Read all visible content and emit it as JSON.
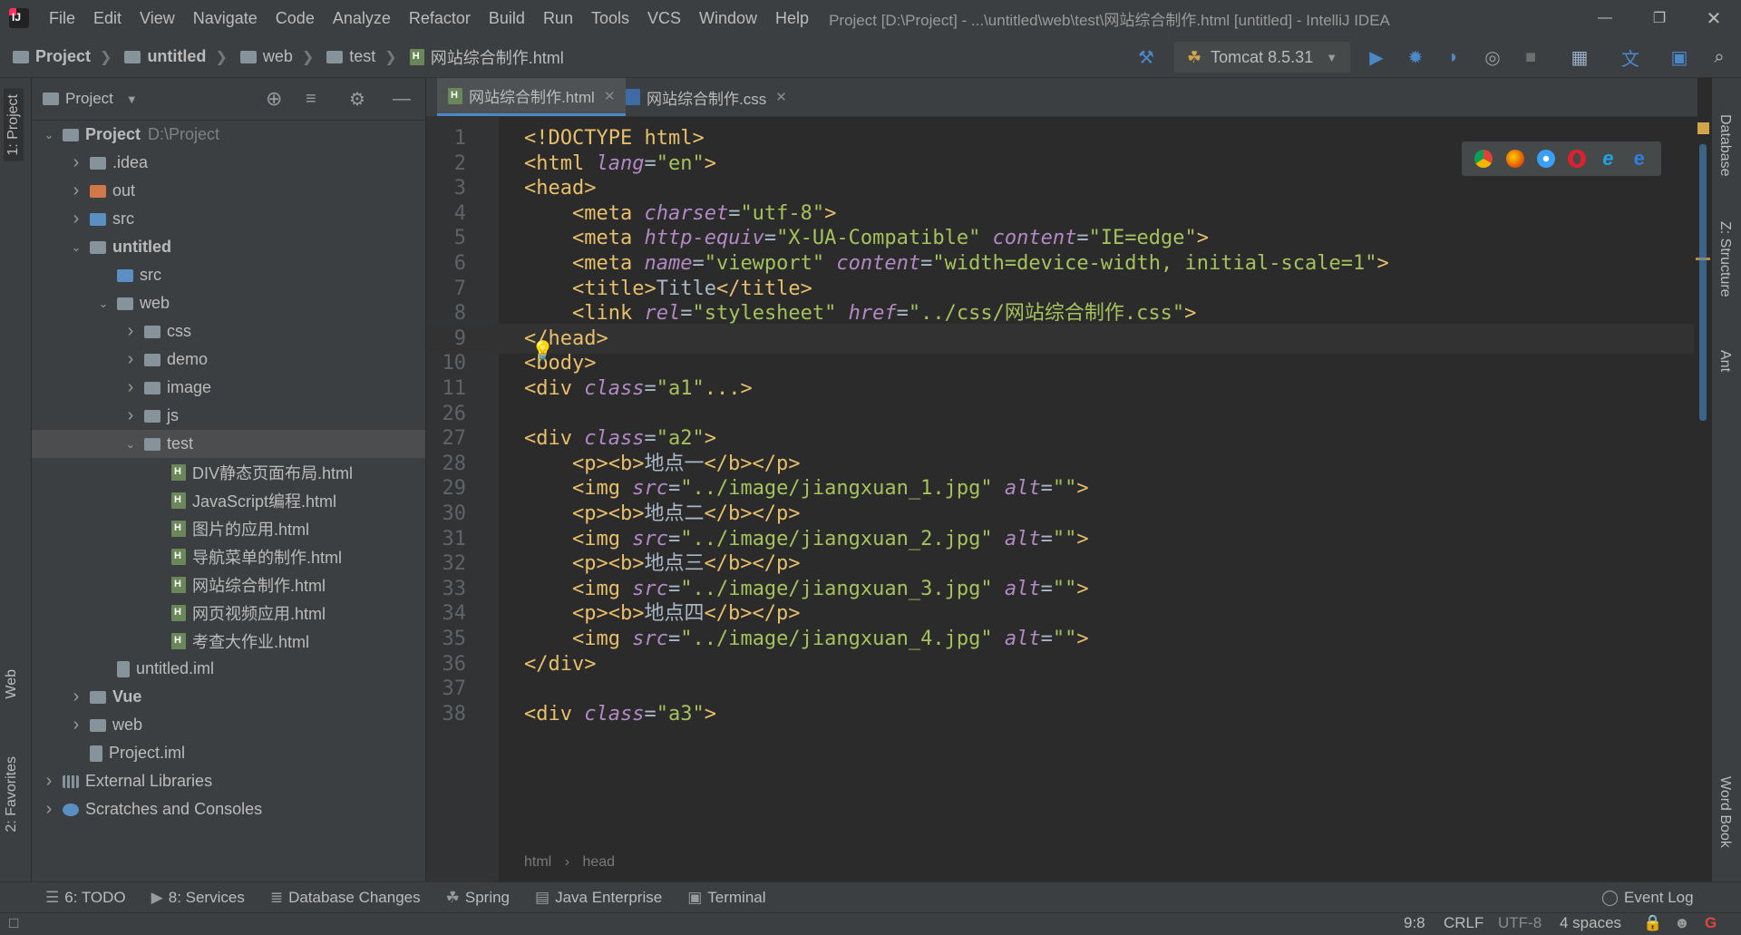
{
  "window": {
    "title": "Project [D:\\Project] - ...\\untitled\\web\\test\\网站综合制作.html [untitled] - IntelliJ IDEA",
    "menu": [
      "File",
      "Edit",
      "View",
      "Navigate",
      "Code",
      "Analyze",
      "Refactor",
      "Build",
      "Run",
      "Tools",
      "VCS",
      "Window",
      "Help"
    ]
  },
  "breadcrumbs": [
    "Project",
    "untitled",
    "web",
    "test",
    "网站综合制作.html"
  ],
  "toolbar": {
    "run_config": "Tomcat 8.5.31"
  },
  "project_panel": {
    "title": "Project",
    "tree": [
      {
        "label": "Project",
        "extra": "D:\\Project",
        "depth": 0,
        "expanded": true,
        "bold": true,
        "icon": "folder"
      },
      {
        "label": ".idea",
        "depth": 1,
        "expanded": false,
        "icon": "folder"
      },
      {
        "label": "out",
        "depth": 1,
        "expanded": false,
        "icon": "folder-orange"
      },
      {
        "label": "src",
        "depth": 1,
        "expanded": false,
        "icon": "folder-blue"
      },
      {
        "label": "untitled",
        "depth": 1,
        "expanded": true,
        "bold": true,
        "icon": "folder"
      },
      {
        "label": "src",
        "depth": 2,
        "icon": "folder-blue"
      },
      {
        "label": "web",
        "depth": 2,
        "expanded": true,
        "icon": "folder"
      },
      {
        "label": "css",
        "depth": 3,
        "expanded": false,
        "icon": "folder"
      },
      {
        "label": "demo",
        "depth": 3,
        "expanded": false,
        "icon": "folder"
      },
      {
        "label": "image",
        "depth": 3,
        "expanded": false,
        "icon": "folder"
      },
      {
        "label": "js",
        "depth": 3,
        "expanded": false,
        "icon": "folder"
      },
      {
        "label": "test",
        "depth": 3,
        "expanded": true,
        "icon": "folder",
        "selected": true
      },
      {
        "label": "DIV静态页面布局.html",
        "depth": 4,
        "icon": "html-file"
      },
      {
        "label": "JavaScript编程.html",
        "depth": 4,
        "icon": "html-file"
      },
      {
        "label": "图片的应用.html",
        "depth": 4,
        "icon": "html-file"
      },
      {
        "label": "导航菜单的制作.html",
        "depth": 4,
        "icon": "html-file"
      },
      {
        "label": "网站综合制作.html",
        "depth": 4,
        "icon": "html-file"
      },
      {
        "label": "网页视频应用.html",
        "depth": 4,
        "icon": "html-file"
      },
      {
        "label": "考查大作业.html",
        "depth": 4,
        "icon": "html-file"
      },
      {
        "label": "untitled.iml",
        "depth": 2,
        "icon": "iml-file"
      },
      {
        "label": "Vue",
        "depth": 1,
        "expanded": false,
        "bold": true,
        "icon": "folder"
      },
      {
        "label": "web",
        "depth": 1,
        "expanded": false,
        "icon": "folder"
      },
      {
        "label": "Project.iml",
        "depth": 1,
        "icon": "iml-file"
      },
      {
        "label": "External Libraries",
        "depth": 0,
        "expanded": false,
        "icon": "library"
      },
      {
        "label": "Scratches and Consoles",
        "depth": 0,
        "expanded": false,
        "icon": "scratch"
      }
    ]
  },
  "editor": {
    "tabs": [
      {
        "label": "网站综合制作.html",
        "active": true,
        "icon": "html-file"
      },
      {
        "label": "网站综合制作.css",
        "active": false,
        "icon": "css-file"
      }
    ],
    "lines": [
      {
        "n": "1",
        "text": "<!DOCTYPE html>"
      },
      {
        "n": "2",
        "text": "<html lang=\"en\">"
      },
      {
        "n": "3",
        "text": "<head>"
      },
      {
        "n": "4",
        "text": "    <meta charset=\"utf-8\">"
      },
      {
        "n": "5",
        "text": "    <meta http-equiv=\"X-UA-Compatible\" content=\"IE=edge\">"
      },
      {
        "n": "6",
        "text": "    <meta name=\"viewport\" content=\"width=device-width, initial-scale=1\">"
      },
      {
        "n": "7",
        "text": "    <title>Title</title>"
      },
      {
        "n": "8",
        "text": "    <link rel=\"stylesheet\" href=\"../css/网站综合制作.css\">"
      },
      {
        "n": "9",
        "text": "</head>",
        "current": true
      },
      {
        "n": "10",
        "text": "<body>"
      },
      {
        "n": "11",
        "text": "<div class=\"a1\"...>"
      },
      {
        "n": "26",
        "text": ""
      },
      {
        "n": "27",
        "text": "<div class=\"a2\">"
      },
      {
        "n": "28",
        "text": "    <p><b>地点一</b></p>"
      },
      {
        "n": "29",
        "text": "    <img src=\"../image/jiangxuan_1.jpg\" alt=\"\">"
      },
      {
        "n": "30",
        "text": "    <p><b>地点二</b></p>"
      },
      {
        "n": "31",
        "text": "    <img src=\"../image/jiangxuan_2.jpg\" alt=\"\">"
      },
      {
        "n": "32",
        "text": "    <p><b>地点三</b></p>"
      },
      {
        "n": "33",
        "text": "    <img src=\"../image/jiangxuan_3.jpg\" alt=\"\">"
      },
      {
        "n": "34",
        "text": "    <p><b>地点四</b></p>"
      },
      {
        "n": "35",
        "text": "    <img src=\"../image/jiangxuan_4.jpg\" alt=\"\">"
      },
      {
        "n": "36",
        "text": "</div>"
      },
      {
        "n": "37",
        "text": ""
      },
      {
        "n": "38",
        "text": "<div class=\"a3\">"
      }
    ],
    "breadcrumb": [
      "html",
      "head"
    ],
    "browsers": [
      "chrome-icon",
      "firefox-icon",
      "safari-icon",
      "opera-icon",
      "ie-icon",
      "edge-icon"
    ]
  },
  "left_tool_tabs": [
    "1: Project",
    "Web",
    "2: Favorites"
  ],
  "right_tool_tabs": [
    "Database",
    "Z: Structure",
    "Ant",
    "Word Book"
  ],
  "bottom_tabs": [
    {
      "label": "6: TODO",
      "icon": "todo-icon"
    },
    {
      "label": "8: Services",
      "icon": "services-icon"
    },
    {
      "label": "Database Changes",
      "icon": "database-changes-icon"
    },
    {
      "label": "Spring",
      "icon": "spring-icon"
    },
    {
      "label": "Java Enterprise",
      "icon": "java-enterprise-icon"
    },
    {
      "label": "Terminal",
      "icon": "terminal-icon"
    }
  ],
  "event_log": "Event Log",
  "status": {
    "position": "9:8",
    "line_separator": "CRLF",
    "encoding": "UTF-8",
    "indent": "4 spaces"
  }
}
